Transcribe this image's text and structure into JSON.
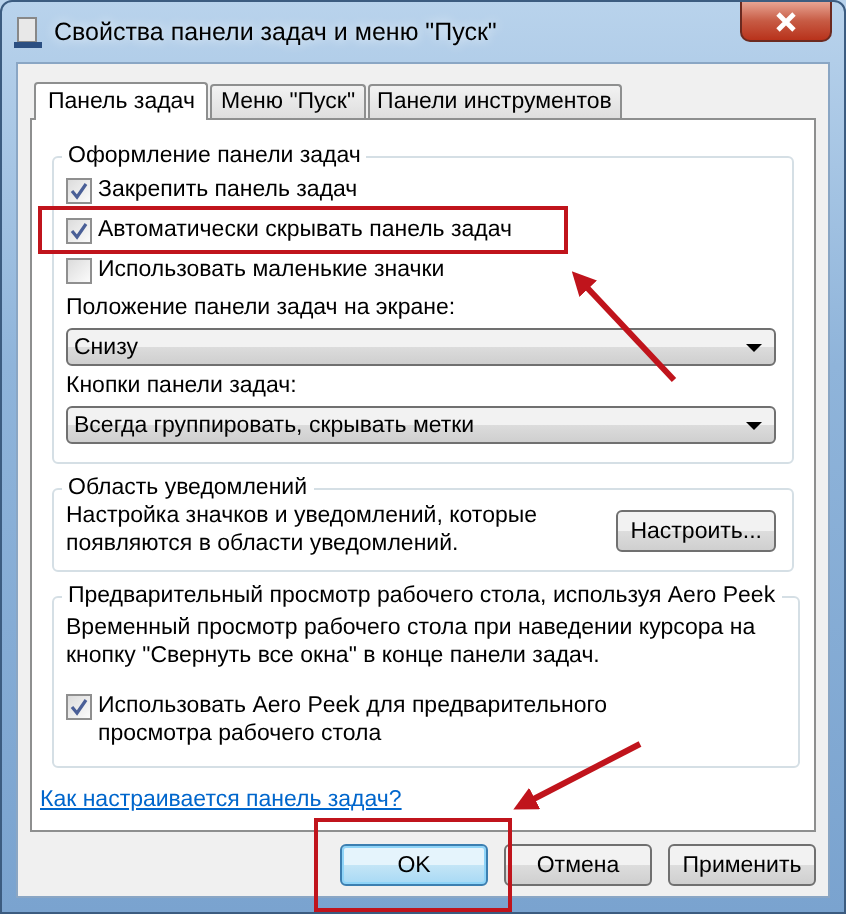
{
  "window": {
    "title": "Свойства панели задач и меню \"Пуск\""
  },
  "tabs": [
    {
      "label": "Панель задач",
      "selected": true
    },
    {
      "label": "Меню \"Пуск\"",
      "selected": false
    },
    {
      "label": "Панели инструментов",
      "selected": false
    }
  ],
  "appearance_group": {
    "title": "Оформление панели задач",
    "checkboxes": [
      {
        "label": "Закрепить панель задач",
        "checked": true
      },
      {
        "label": "Автоматически скрывать панель задач",
        "checked": true
      },
      {
        "label": "Использовать маленькие значки",
        "checked": false
      }
    ],
    "fields": [
      {
        "label": "Положение панели задач на экране:",
        "value": "Снизу"
      },
      {
        "label": "Кнопки панели задач:",
        "value": "Всегда группировать, скрывать метки"
      }
    ]
  },
  "notification_group": {
    "title": "Область уведомлений",
    "text": "Настройка значков и уведомлений, которые появляются в области уведомлений.",
    "button": "Настроить..."
  },
  "peek_group": {
    "title": "Предварительный просмотр рабочего стола, используя Aero Peek",
    "text": "Временный просмотр рабочего стола при наведении курсора на кнопку \"Свернуть все окна\" в конце панели задач.",
    "checkbox": {
      "label": "Использовать Aero Peek для предварительного просмотра рабочего стола",
      "checked": true
    }
  },
  "help_link": "Как настраивается панель задач?",
  "buttons": [
    {
      "label": "OK",
      "default": true
    },
    {
      "label": "Отмена",
      "default": false
    },
    {
      "label": "Применить",
      "default": false
    }
  ]
}
